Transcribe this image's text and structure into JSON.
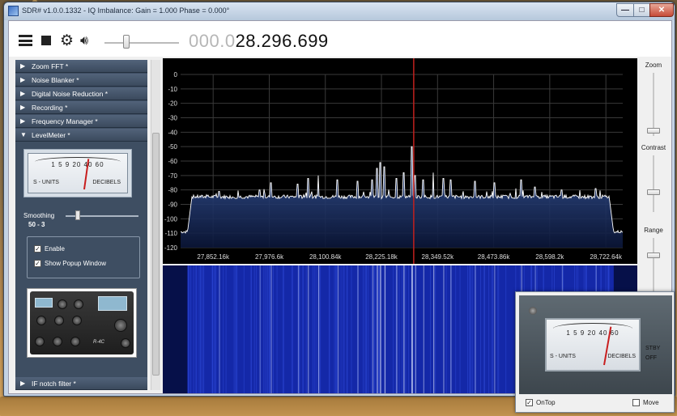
{
  "window": {
    "title": "SDR# v1.0.0.1332 - IQ Imbalance: Gain = 1.000 Phase = 0.000°",
    "minimize": "—",
    "maximize": "□",
    "close": "✕"
  },
  "toolbar": {
    "frequency_dim": "000.0",
    "frequency_main": "28.296.699",
    "volume_level": 0.3
  },
  "panels": [
    {
      "label": "Zoom FFT *",
      "expanded": false
    },
    {
      "label": "Noise Blanker *",
      "expanded": false
    },
    {
      "label": "Digital Noise Reduction *",
      "expanded": false
    },
    {
      "label": "Recording *",
      "expanded": false
    },
    {
      "label": "Frequency Manager *",
      "expanded": false
    },
    {
      "label": "LevelMeter *",
      "expanded": true
    },
    {
      "label": "IF notch filter *",
      "expanded": false
    }
  ],
  "levelmeter": {
    "scale": "1  5  9 20 40 60",
    "s_units": "S - UNITS",
    "decibels": "DECIBELS",
    "smoothing_label": "Smoothing",
    "smoothing_value": "50 - 3",
    "enable_label": "Enable",
    "enable_checked": true,
    "popup_label": "Show Popup Window",
    "popup_checked": true
  },
  "radio": {
    "model": "R-4C"
  },
  "right_controls": {
    "zoom": "Zoom",
    "contrast": "Contrast",
    "range": "Range"
  },
  "popup": {
    "scale": "1  5  9 20 40 60",
    "s_units": "S - UNITS",
    "decibels": "DECIBELS",
    "stby": "STBY",
    "off": "OFF",
    "ontop_label": "OnTop",
    "ontop_checked": true,
    "move_label": "Move",
    "move_checked": false
  },
  "chart_data": {
    "type": "line",
    "title": "",
    "xlabel": "",
    "ylabel": "",
    "y_ticks": [
      0,
      -10,
      -20,
      -30,
      -40,
      -50,
      -60,
      -70,
      -80,
      -90,
      -100,
      -110,
      -120
    ],
    "ylim": [
      -120,
      0
    ],
    "x_tick_labels": [
      "27,852.16k",
      "27,976.6k",
      "28,100.84k",
      "28,225.18k",
      "28,349.52k",
      "28,473.86k",
      "28,598.2k",
      "28,722.64k"
    ],
    "x_ticks_k": [
      27852.16,
      27976.6,
      28100.84,
      28225.18,
      28349.52,
      28473.86,
      28598.2,
      28722.64
    ],
    "xlim_k": [
      27780,
      28760
    ],
    "center_k": 28296.699,
    "grid": true,
    "noise_floor_db": -85,
    "passband_k": [
      27795,
      28740
    ],
    "out_of_band_db": -110,
    "peaks": [
      {
        "x_k": 27865,
        "db": -81
      },
      {
        "x_k": 27955,
        "db": -80
      },
      {
        "x_k": 27980,
        "db": -75
      },
      {
        "x_k": 28040,
        "db": -76
      },
      {
        "x_k": 28062,
        "db": -72
      },
      {
        "x_k": 28085,
        "db": -70
      },
      {
        "x_k": 28128,
        "db": -73
      },
      {
        "x_k": 28172,
        "db": -74
      },
      {
        "x_k": 28205,
        "db": -73
      },
      {
        "x_k": 28215,
        "db": -65
      },
      {
        "x_k": 28222,
        "db": -61
      },
      {
        "x_k": 28232,
        "db": -64
      },
      {
        "x_k": 28258,
        "db": -72
      },
      {
        "x_k": 28274,
        "db": -68
      },
      {
        "x_k": 28292,
        "db": -50
      },
      {
        "x_k": 28300,
        "db": -70
      },
      {
        "x_k": 28318,
        "db": -73
      },
      {
        "x_k": 28340,
        "db": -68
      },
      {
        "x_k": 28362,
        "db": -72
      },
      {
        "x_k": 28378,
        "db": -73
      },
      {
        "x_k": 28432,
        "db": -74
      },
      {
        "x_k": 28475,
        "db": -75
      },
      {
        "x_k": 28535,
        "db": -73
      },
      {
        "x_k": 28565,
        "db": -78
      },
      {
        "x_k": 28625,
        "db": -80
      },
      {
        "x_k": 28700,
        "db": -79
      }
    ]
  }
}
